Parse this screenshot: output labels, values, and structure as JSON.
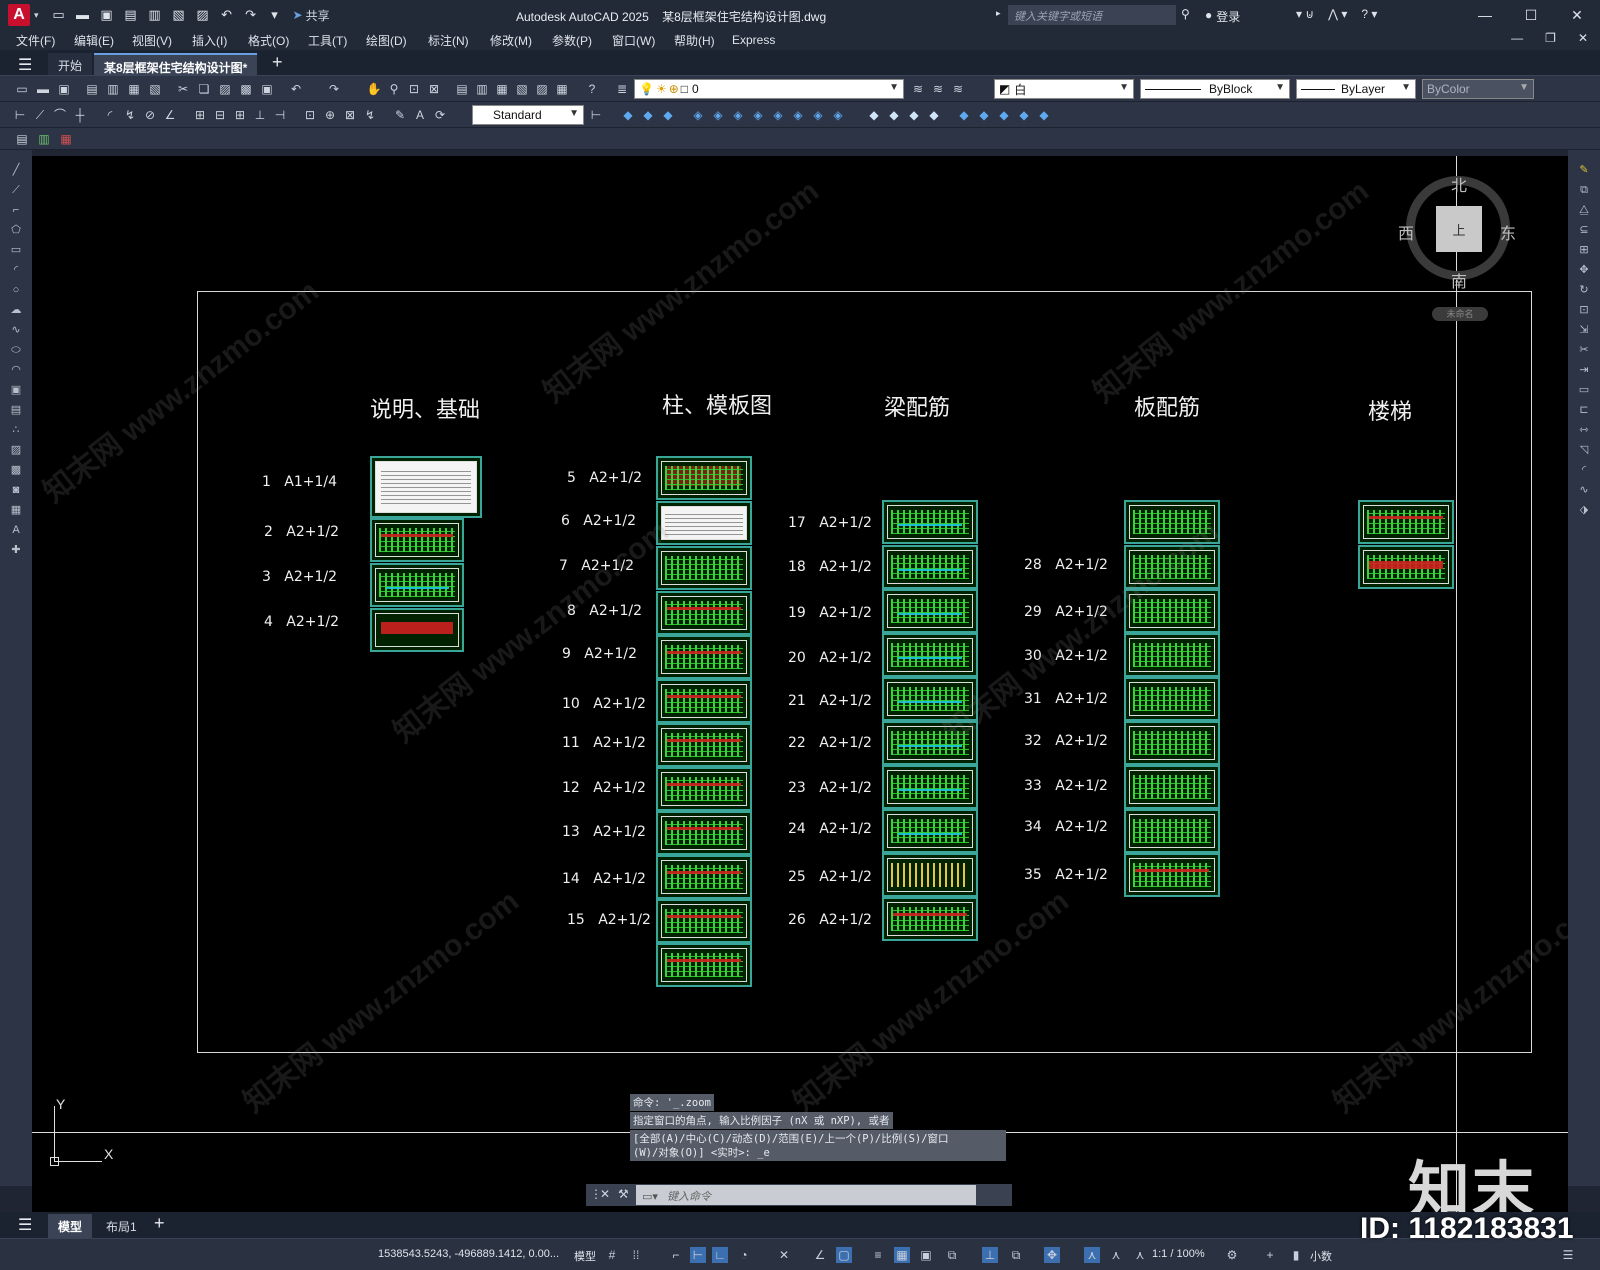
{
  "app": {
    "title": "Autodesk AutoCAD 2025",
    "document": "某8层框架住宅结构设计图.dwg",
    "logo": "A"
  },
  "titlebar": {
    "share": "共享",
    "search_placeholder": "键入关键字或短语",
    "login": "登录"
  },
  "menu": [
    "文件(F)",
    "编辑(E)",
    "视图(V)",
    "插入(I)",
    "格式(O)",
    "工具(T)",
    "绘图(D)",
    "标注(N)",
    "修改(M)",
    "参数(P)",
    "窗口(W)",
    "帮助(H)",
    "Express"
  ],
  "tabs": {
    "start": "开始",
    "document": "某8层框架住宅结构设计图*"
  },
  "toolbar": {
    "layer": "0",
    "color": "白",
    "linetype": "ByBlock",
    "lineweight": "ByLayer",
    "plotstyle": "ByColor",
    "text_style": "Standard"
  },
  "drawing": {
    "sections": [
      "说明、基础",
      "柱、模板图",
      "梁配筋",
      "板配筋",
      "楼梯"
    ],
    "col1": [
      {
        "n": "1",
        "s": "A1+1/4"
      },
      {
        "n": "2",
        "s": "A2+1/2"
      },
      {
        "n": "3",
        "s": "A2+1/2"
      },
      {
        "n": "4",
        "s": "A2+1/2"
      }
    ],
    "col2": [
      {
        "n": "5",
        "s": "A2+1/2"
      },
      {
        "n": "6",
        "s": "A2+1/2"
      },
      {
        "n": "7",
        "s": "A2+1/2"
      },
      {
        "n": "8",
        "s": "A2+1/2"
      },
      {
        "n": "9",
        "s": "A2+1/2"
      },
      {
        "n": "10",
        "s": "A2+1/2"
      },
      {
        "n": "11",
        "s": "A2+1/2"
      },
      {
        "n": "12",
        "s": "A2+1/2"
      },
      {
        "n": "13",
        "s": "A2+1/2"
      },
      {
        "n": "14",
        "s": "A2+1/2"
      },
      {
        "n": "15",
        "s": "A2+1/2"
      }
    ],
    "col3": [
      {
        "n": "17",
        "s": "A2+1/2"
      },
      {
        "n": "18",
        "s": "A2+1/2"
      },
      {
        "n": "19",
        "s": "A2+1/2"
      },
      {
        "n": "20",
        "s": "A2+1/2"
      },
      {
        "n": "21",
        "s": "A2+1/2"
      },
      {
        "n": "22",
        "s": "A2+1/2"
      },
      {
        "n": "23",
        "s": "A2+1/2"
      },
      {
        "n": "24",
        "s": "A2+1/2"
      },
      {
        "n": "25",
        "s": "A2+1/2"
      },
      {
        "n": "26",
        "s": "A2+1/2"
      }
    ],
    "col4": [
      {
        "n": "28",
        "s": "A2+1/2"
      },
      {
        "n": "29",
        "s": "A2+1/2"
      },
      {
        "n": "30",
        "s": "A2+1/2"
      },
      {
        "n": "31",
        "s": "A2+1/2"
      },
      {
        "n": "32",
        "s": "A2+1/2"
      },
      {
        "n": "33",
        "s": "A2+1/2"
      },
      {
        "n": "34",
        "s": "A2+1/2"
      },
      {
        "n": "35",
        "s": "A2+1/2"
      }
    ]
  },
  "viewcube": {
    "north": "北",
    "south": "南",
    "east": "东",
    "west": "西",
    "top": "上",
    "wcs": "未命名"
  },
  "ucs": {
    "x": "X",
    "y": "Y"
  },
  "command": {
    "history": [
      "命令: '_.zoom",
      "指定窗口的角点, 输入比例因子 (nX 或 nXP), 或者",
      "[全部(A)/中心(C)/动态(D)/范围(E)/上一个(P)/比例(S)/窗口",
      "(W)/对象(O)] <实时>: _e"
    ],
    "placeholder": "键入命令"
  },
  "layouts": {
    "model": "模型",
    "layout1": "布局1"
  },
  "status": {
    "coords": "1538543.5243, -496889.1412, 0.00...",
    "space": "模型",
    "scale": "1:1 / 100%",
    "units": "小数"
  },
  "watermark": {
    "text": "知末网 www.znzmo.com",
    "brand": "知末",
    "id": "ID: 1182183831"
  }
}
